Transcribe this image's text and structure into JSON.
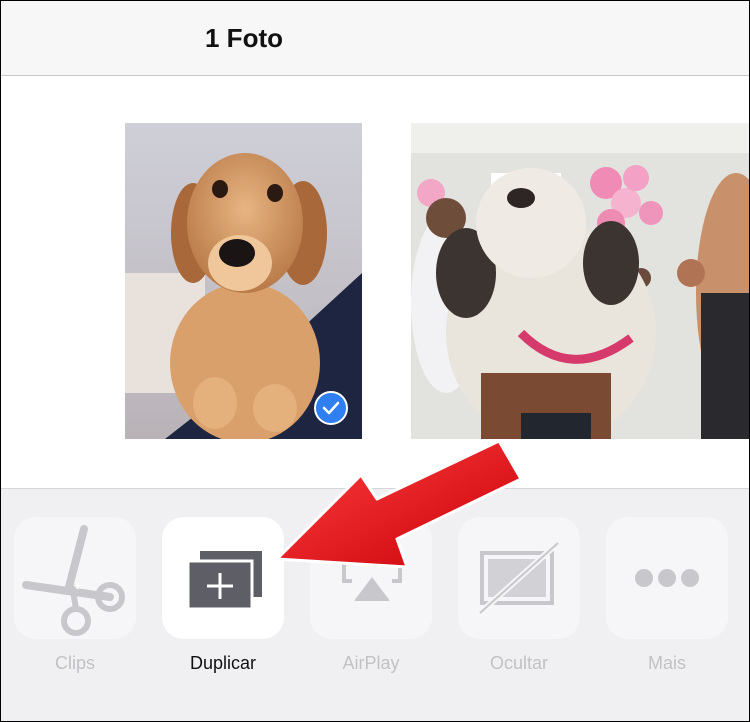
{
  "header": {
    "title": "1 Foto"
  },
  "photos": [
    {
      "subject": "golden-retriever-puppy",
      "selected": true
    },
    {
      "subject": "shih-tzu-party",
      "selected": false
    }
  ],
  "actions": [
    {
      "label": "Clips",
      "icon": "scissors-icon",
      "enabled": false
    },
    {
      "label": "Duplicar",
      "icon": "duplicate-icon",
      "enabled": true
    },
    {
      "label": "AirPlay",
      "icon": "airplay-icon",
      "enabled": false
    },
    {
      "label": "Ocultar",
      "icon": "hide-icon",
      "enabled": false
    },
    {
      "label": "Mais",
      "icon": "more-icon",
      "enabled": false
    }
  ],
  "colors": {
    "accent": "#2f7ff0",
    "arrow": "#e8101a",
    "disabled": "#c2c2c6"
  }
}
